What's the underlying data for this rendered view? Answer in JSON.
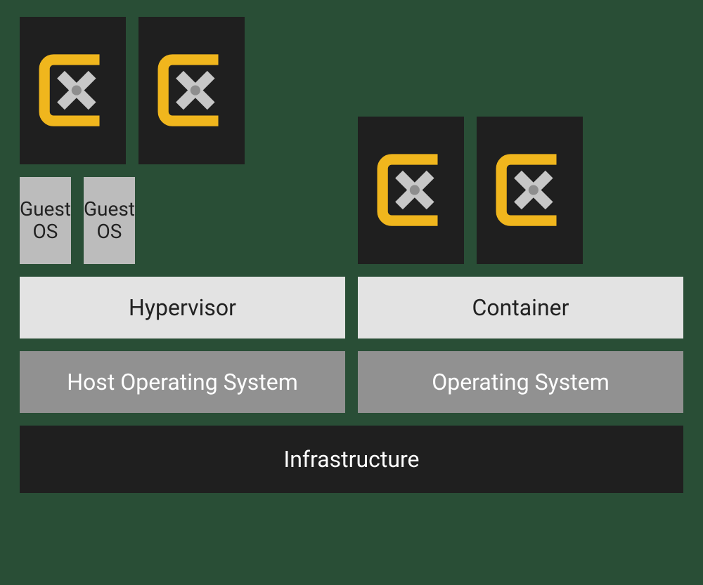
{
  "vm_stack": {
    "icons": [
      "app-icon",
      "app-icon"
    ],
    "guest_os": [
      "Guest\nOS",
      "Guest\nOS"
    ],
    "platform": "Hypervisor",
    "os": "Host Operating System"
  },
  "container_stack": {
    "icons": [
      "app-icon",
      "app-icon"
    ],
    "platform": "Container",
    "os": "Operating System"
  },
  "infrastructure": "Infrastructure",
  "icon_label": "app-icon"
}
